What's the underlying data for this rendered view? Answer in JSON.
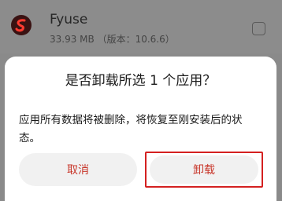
{
  "app": {
    "name": "Fyuse",
    "meta": "33.93 MB （版本：10.6.6）"
  },
  "dialog": {
    "title": "是否卸载所选 1 个应用？",
    "message": "应用所有数据将被删除，将恢复至刚安装后的状态。",
    "cancel_label": "取消",
    "uninstall_label": "卸载"
  },
  "colors": {
    "accent": "#c8372b",
    "highlight_border": "#d42020"
  },
  "icons": {
    "app_icon": "fyuse-app-icon",
    "checkbox": "checkbox-unchecked"
  }
}
